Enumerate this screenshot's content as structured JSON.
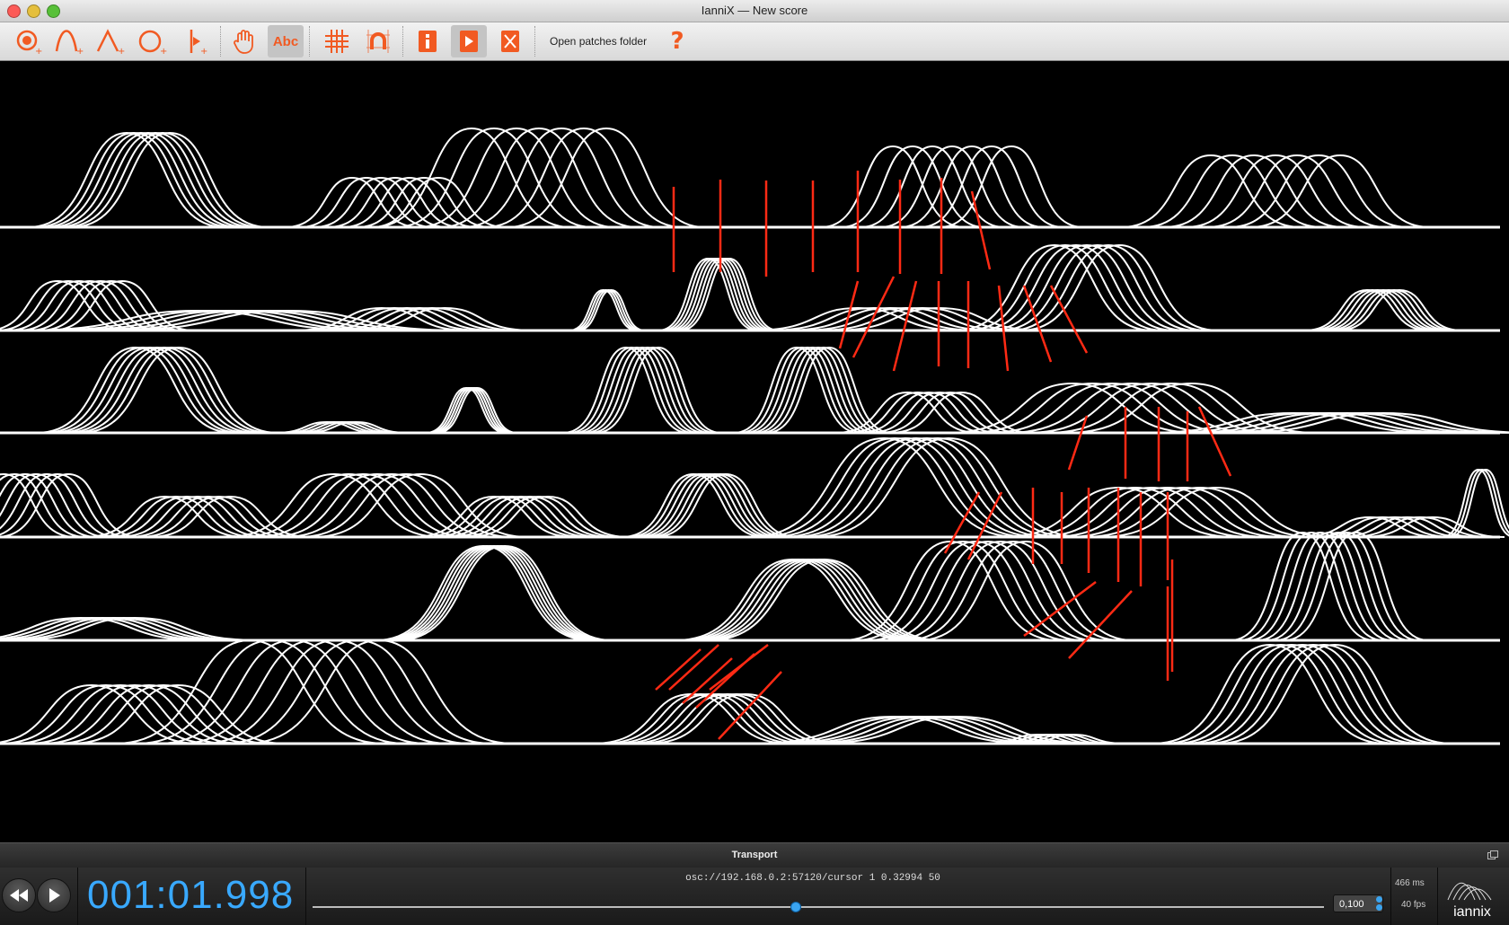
{
  "window": {
    "title": "IanniX — New score",
    "traffic_lights": [
      {
        "name": "close",
        "color": "#fc5b57"
      },
      {
        "name": "minimize",
        "color": "#e5bf3c"
      },
      {
        "name": "zoom",
        "color": "#57c038"
      }
    ]
  },
  "toolbar": {
    "accent_color": "#f15a22",
    "tools": [
      {
        "icon": "add-trigger-icon",
        "active": false
      },
      {
        "icon": "add-curve-icon",
        "active": false
      },
      {
        "icon": "add-polyline-icon",
        "active": false
      },
      {
        "icon": "add-circle-icon",
        "active": false
      },
      {
        "icon": "add-cursor-icon",
        "active": false
      },
      {
        "icon": "hand-icon",
        "active": false
      },
      {
        "icon": "text-icon",
        "label": "Abc",
        "active": true
      },
      {
        "icon": "grid-icon",
        "active": false
      },
      {
        "icon": "snap-magnet-icon",
        "active": false
      },
      {
        "icon": "info-icon",
        "active": false
      },
      {
        "icon": "play-render-icon",
        "active": true
      },
      {
        "icon": "fullscreen-icon",
        "active": false
      }
    ],
    "open_patches_label": "Open patches folder",
    "help_icon": "question-mark-icon"
  },
  "score": {
    "background": "#000000",
    "curve_color": "#ffffff",
    "cursor_color": "#ff2a14"
  },
  "transport": {
    "title": "Transport",
    "time": "001:01.998",
    "osc_message": "osc://192.168.0.2:57120/cursor 1 0.32994 50",
    "progress": 0.477,
    "speed": "0,100",
    "latency": "466 ms",
    "fps": "40 fps",
    "logo_text": "iannix",
    "accent_color": "#39a9ff",
    "buttons": [
      {
        "icon": "rewind-icon"
      },
      {
        "icon": "play-icon"
      }
    ]
  }
}
